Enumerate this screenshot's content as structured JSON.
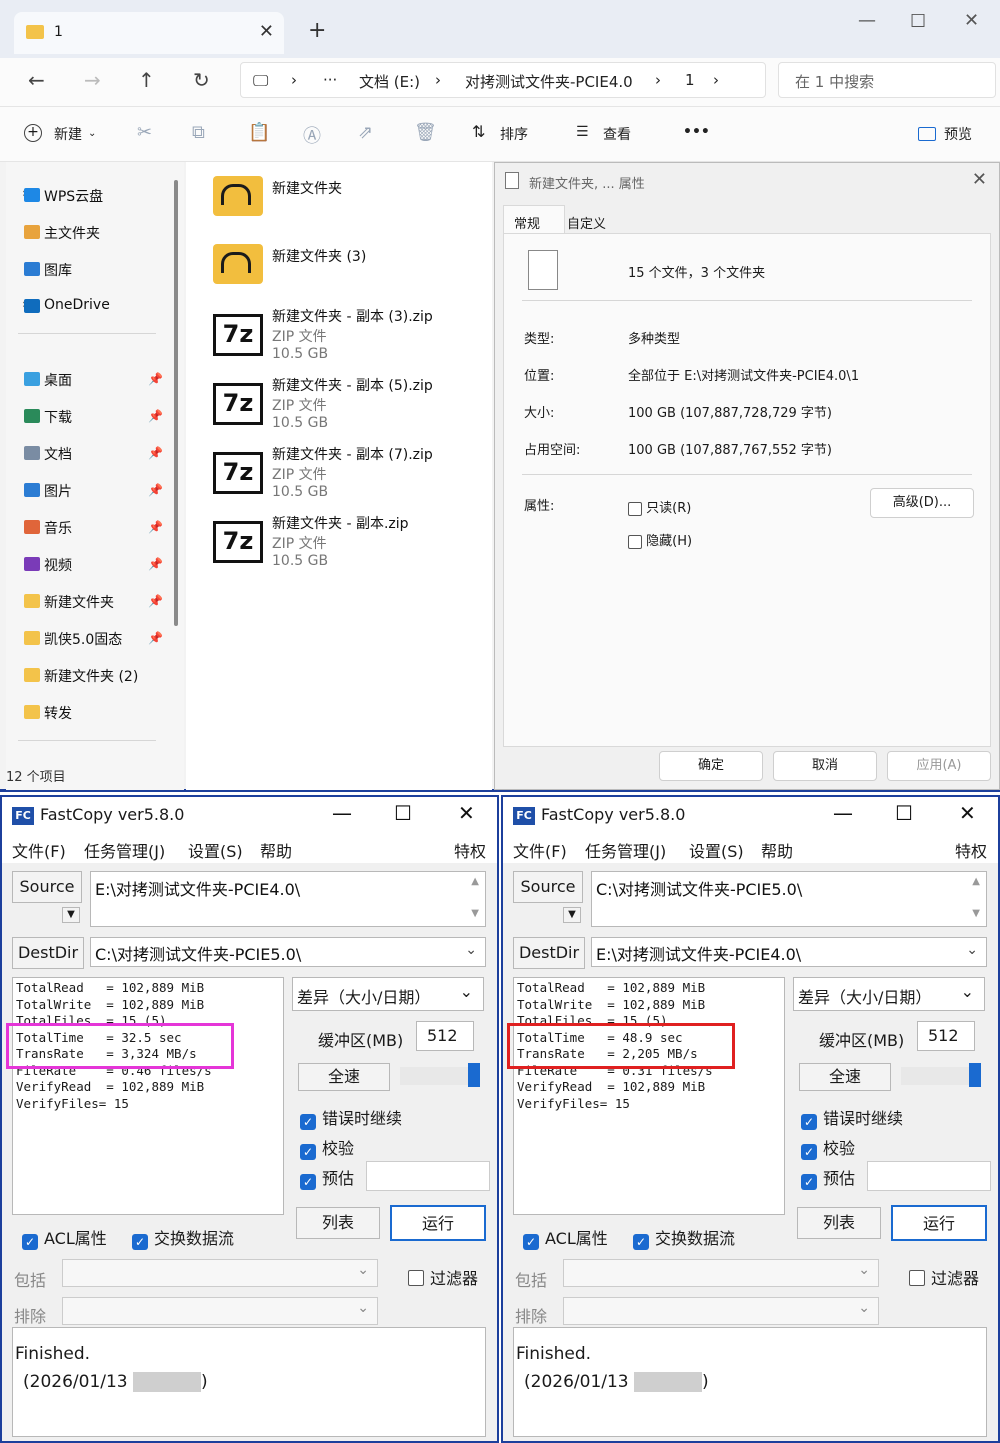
{
  "explorer": {
    "tab_label": "1",
    "breadcrumb": [
      "文档 (E:)",
      "对拷测试文件夹-PCIE4.0",
      "1"
    ],
    "search_placeholder": "在 1 中搜索",
    "toolbar": {
      "new": "新建",
      "sort": "排序",
      "view": "查看",
      "more": "•••",
      "preview": "预览"
    },
    "sidebar": [
      {
        "label": "WPS云盘",
        "icon": "cloud-icon",
        "color": "#1e88e5"
      },
      {
        "label": "主文件夹",
        "icon": "home-icon",
        "color": "#e8a33d"
      },
      {
        "label": "图库",
        "icon": "gallery-icon",
        "color": "#2b7cd3"
      },
      {
        "label": "OneDrive",
        "icon": "onedrive-icon",
        "color": "#0f6cbd"
      },
      {
        "label": "桌面",
        "icon": "desktop-icon",
        "color": "#3aa0e0"
      },
      {
        "label": "下载",
        "icon": "download-icon",
        "color": "#2a8a5a"
      },
      {
        "label": "文档",
        "icon": "document-icon",
        "color": "#7a8ca3"
      },
      {
        "label": "图片",
        "icon": "pictures-icon",
        "color": "#2b7cd3"
      },
      {
        "label": "音乐",
        "icon": "music-icon",
        "color": "#e0653a"
      },
      {
        "label": "视频",
        "icon": "video-icon",
        "color": "#7a3bb8"
      },
      {
        "label": "新建文件夹",
        "icon": "folder-icon",
        "color": "#f3c34a"
      },
      {
        "label": "凯侠5.0固态",
        "icon": "folder-icon",
        "color": "#f3c34a"
      },
      {
        "label": "新建文件夹 (2)",
        "icon": "folder-icon",
        "color": "#f3c34a"
      },
      {
        "label": "转发",
        "icon": "folder-icon",
        "color": "#f3c34a"
      }
    ],
    "files": [
      {
        "name": "新建文件夹",
        "type": "",
        "size": ""
      },
      {
        "name": "新建文件夹 (3)",
        "type": "",
        "size": ""
      },
      {
        "name": "新建文件夹 - 副本 (3).zip",
        "type": "ZIP 文件",
        "size": "10.5 GB"
      },
      {
        "name": "新建文件夹 - 副本 (5).zip",
        "type": "ZIP 文件",
        "size": "10.5 GB"
      },
      {
        "name": "新建文件夹 - 副本 (7).zip",
        "type": "ZIP 文件",
        "size": "10.5 GB"
      },
      {
        "name": "新建文件夹 - 副本.zip",
        "type": "ZIP 文件",
        "size": "10.5 GB"
      }
    ],
    "status": "12 个项目"
  },
  "properties": {
    "title": "新建文件夹, ... 属性",
    "tabs": [
      "常规",
      "自定义"
    ],
    "summary": "15 个文件，3 个文件夹",
    "type_label": "类型:",
    "type_value": "多种类型",
    "location_label": "位置:",
    "location_value": "全部位于 E:\\对拷测试文件夹-PCIE4.0\\1",
    "size_label": "大小:",
    "size_value": "100 GB (107,887,728,729 字节)",
    "disk_label": "占用空间:",
    "disk_value": "100 GB (107,887,767,552 字节)",
    "attr_label": "属性:",
    "readonly": "只读(R)",
    "hidden": "隐藏(H)",
    "advanced": "高级(D)...",
    "ok": "确定",
    "cancel": "取消",
    "apply": "应用(A)"
  },
  "fastcopy": [
    {
      "title": "FastCopy ver5.8.0",
      "menu": [
        "文件(F)",
        "任务管理(J)",
        "设置(S)",
        "帮助",
        "特权"
      ],
      "source_label": "Source",
      "source_path": "E:\\对拷测试文件夹-PCIE4.0\\",
      "dest_label": "DestDir",
      "dest_path": "C:\\对拷测试文件夹-PCIE5.0\\",
      "stats": "TotalRead   = 102,889 MiB\nTotalWrite  = 102,889 MiB\nTotalFiles  = 15 (5)\nTotalTime   = 32.5 sec\nTransRate   = 3,324 MB/s\nFileRate    = 0.46 files/s\nVerifyRead  = 102,889 MiB\nVerifyFiles= 15",
      "mode": "差异（大小/日期）",
      "buffer_label": "缓冲区(MB)",
      "buffer_value": "512",
      "speed": "全速",
      "opt1": "错误时继续",
      "opt2": "校验",
      "opt3": "预估",
      "list": "列表",
      "run": "运行",
      "acl": "ACL属性",
      "stream": "交换数据流",
      "include": "包括",
      "exclude": "排除",
      "filter": "过滤器",
      "log1": "Finished.",
      "log2": "(2026/01/13",
      "log2_end": ")",
      "highlight_color": "#e535d8"
    },
    {
      "title": "FastCopy ver5.8.0",
      "menu": [
        "文件(F)",
        "任务管理(J)",
        "设置(S)",
        "帮助",
        "特权"
      ],
      "source_label": "Source",
      "source_path": "C:\\对拷测试文件夹-PCIE5.0\\",
      "dest_label": "DestDir",
      "dest_path": "E:\\对拷测试文件夹-PCIE4.0\\",
      "stats": "TotalRead   = 102,889 MiB\nTotalWrite  = 102,889 MiB\nTotalFiles  = 15 (5)\nTotalTime   = 48.9 sec\nTransRate   = 2,205 MB/s\nFileRate    = 0.31 files/s\nVerifyRead  = 102,889 MiB\nVerifyFiles= 15",
      "mode": "差异（大小/日期）",
      "buffer_label": "缓冲区(MB)",
      "buffer_value": "512",
      "speed": "全速",
      "opt1": "错误时继续",
      "opt2": "校验",
      "opt3": "预估",
      "list": "列表",
      "run": "运行",
      "acl": "ACL属性",
      "stream": "交换数据流",
      "include": "包括",
      "exclude": "排除",
      "filter": "过滤器",
      "log1": "Finished.",
      "log2": "(2026/01/13",
      "log2_end": ")",
      "highlight_color": "#e02020"
    }
  ]
}
